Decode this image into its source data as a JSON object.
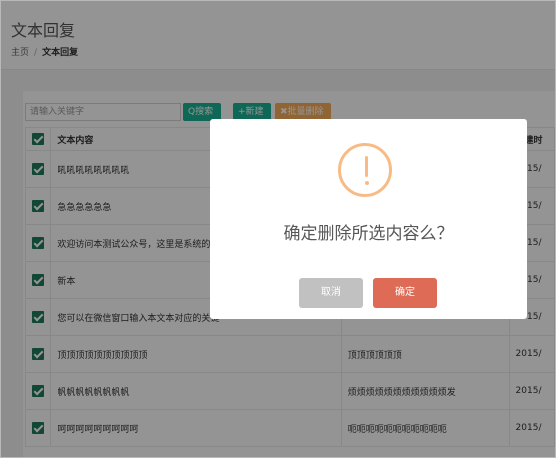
{
  "page": {
    "title": "文本回复",
    "breadcrumb": {
      "home": "主页",
      "current": "文本回复"
    }
  },
  "toolbar": {
    "search_placeholder": "请输入关键字",
    "search_label": "Q搜索",
    "new_label": "+新建",
    "batch_delete_label": "✖批量删除"
  },
  "table": {
    "headers": {
      "content": "文本内容",
      "date": "创建时"
    },
    "rows": [
      {
        "content": "吼吼吼吼吼吼吼吼",
        "middle": "",
        "date": "2015/"
      },
      {
        "content": "急急急急急急",
        "middle": "",
        "date": "2015/"
      },
      {
        "content": "欢迎访问本测试公众号，这里是系统的自",
        "middle": "",
        "date": "2015/"
      },
      {
        "content": "新本",
        "middle": "",
        "date": "2015/"
      },
      {
        "content": "您可以在微信窗口输入本文本对应的关键",
        "middle": "",
        "date": "2015/"
      },
      {
        "content": "顶顶顶顶顶顶顶顶顶顶",
        "middle": "顶顶顶顶顶顶",
        "date": "2015/"
      },
      {
        "content": "帆帆帆帆帆帆帆帆",
        "middle": "烦烦烦烦烦烦烦烦烦烦烦发",
        "date": "2015/"
      },
      {
        "content": "呵呵呵呵呵呵呵呵呵",
        "middle": "呃呃呃呃呃呃呃呃呃呃呃",
        "date": "2015/"
      }
    ]
  },
  "modal": {
    "message": "确定删除所选内容么？",
    "cancel_label": "取消",
    "confirm_label": "确定",
    "colors": {
      "warning": "#f8bb86",
      "confirm": "#dd6b55",
      "cancel": "#c1c1c1"
    }
  }
}
